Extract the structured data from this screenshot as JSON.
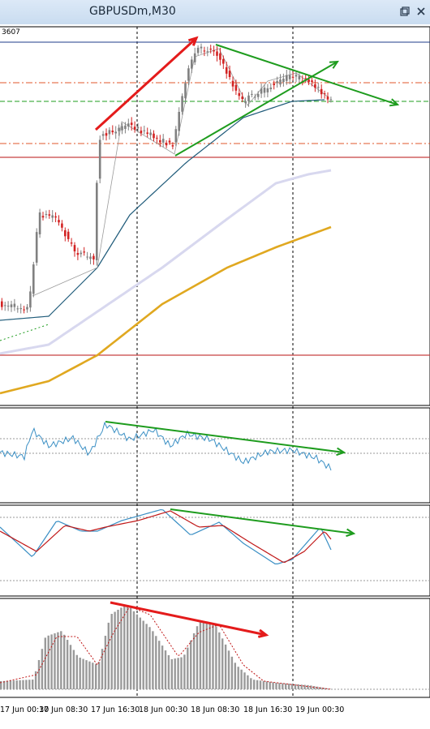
{
  "window": {
    "title": "GBPUSDm,M30"
  },
  "chart_data": {
    "type": "candlestick",
    "symbol": "GBPUSDm",
    "timeframe": "M30",
    "price_tick_label": "3607",
    "x_tick_labels": [
      "17 Jun 00:30",
      "17 Jun 08:30",
      "17 Jun 16:30",
      "18 Jun 00:30",
      "18 Jun 08:30",
      "18 Jun 16:30",
      "19 Jun 00:30"
    ],
    "session_separators": [
      "18 Jun 00:00",
      "19 Jun 00:00"
    ],
    "panels": [
      "price",
      "rsi",
      "stochastic",
      "histogram"
    ],
    "colors": {
      "bull_candle": "#808080",
      "bear_candle": "#d22222",
      "ma_fast": "#1f5b7a",
      "ma_mid": "#d8d8ef",
      "ma_slow": "#e0a820",
      "trend_up": "#e41b1b",
      "trend_down": "#1e9c1e",
      "resistance": "#c84040",
      "pivot_dash": "#e0572b"
    },
    "annotations": {
      "price": [
        "up-arrow",
        "wedge-upper",
        "wedge-lower"
      ],
      "rsi": [
        "divergence-line"
      ],
      "stochastic": [
        "divergence-line"
      ],
      "histogram": [
        "divergence-line"
      ]
    }
  }
}
